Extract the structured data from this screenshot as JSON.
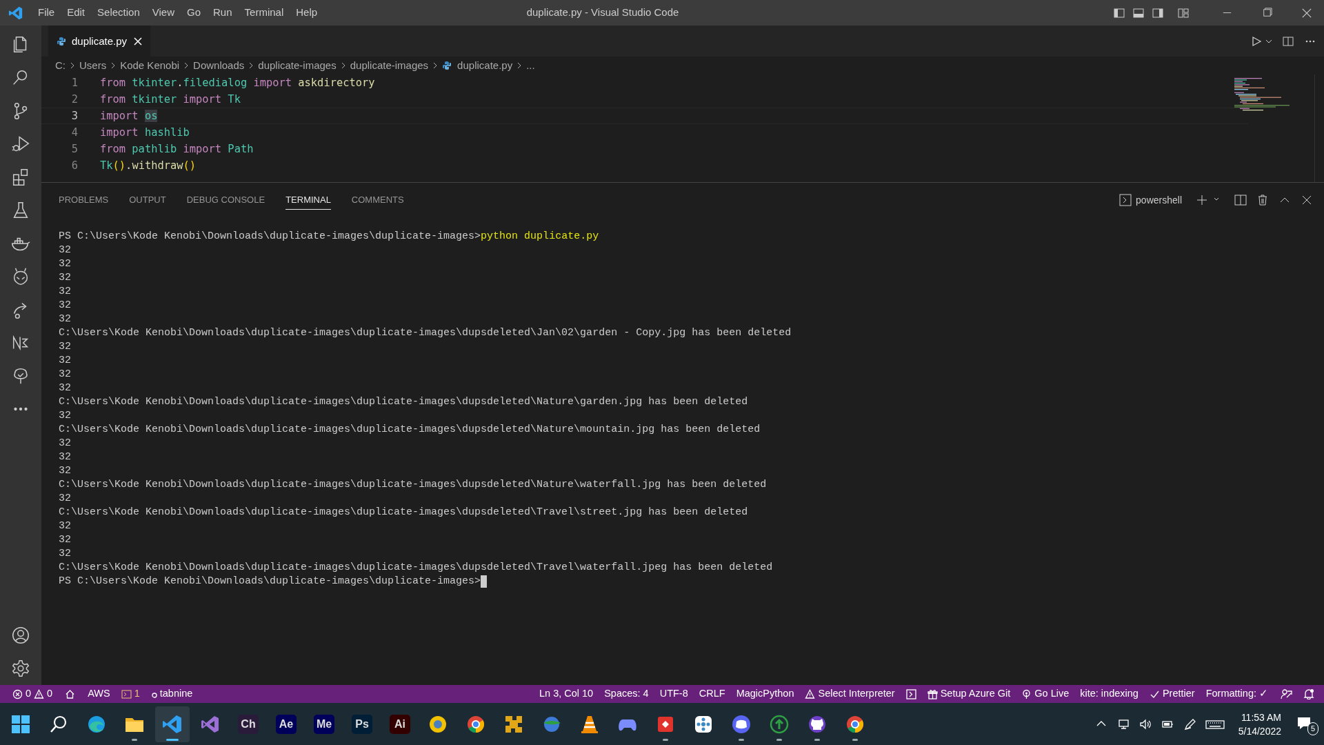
{
  "window": {
    "title": "duplicate.py - Visual Studio Code"
  },
  "menu": [
    "File",
    "Edit",
    "Selection",
    "View",
    "Go",
    "Run",
    "Terminal",
    "Help"
  ],
  "editor_tabs": [
    {
      "label": "duplicate.py",
      "selected": true
    }
  ],
  "breadcrumb": [
    "C:",
    "Users",
    "Kode Kenobi",
    "Downloads",
    "duplicate-images",
    "duplicate-images",
    "duplicate.py",
    "..."
  ],
  "code": [
    {
      "number": "1",
      "current": false,
      "tokens": [
        {
          "kind": "keyword",
          "text": "from",
          "space_after": true
        },
        {
          "kind": "module",
          "text": "tkinter"
        },
        {
          "kind": "plain",
          "text": "."
        },
        {
          "kind": "module",
          "text": "filedialog",
          "space_after": true
        },
        {
          "kind": "keyword",
          "text": "import",
          "space_after": true
        },
        {
          "kind": "func",
          "text": "askdirectory"
        }
      ]
    },
    {
      "number": "2",
      "current": false,
      "tokens": [
        {
          "kind": "keyword",
          "text": "from",
          "space_after": true
        },
        {
          "kind": "module",
          "text": "tkinter",
          "space_after": true
        },
        {
          "kind": "keyword",
          "text": "import",
          "space_after": true
        },
        {
          "kind": "module",
          "text": "Tk"
        }
      ]
    },
    {
      "number": "3",
      "current": true,
      "tokens": [
        {
          "kind": "keyword",
          "text": "import",
          "space_after": true
        },
        {
          "kind": "highlight",
          "text": "os"
        }
      ]
    },
    {
      "number": "4",
      "current": false,
      "tokens": [
        {
          "kind": "keyword",
          "text": "import",
          "space_after": true
        },
        {
          "kind": "module",
          "text": "hashlib"
        }
      ]
    },
    {
      "number": "5",
      "current": false,
      "tokens": [
        {
          "kind": "keyword",
          "text": "from",
          "space_after": true
        },
        {
          "kind": "module",
          "text": "pathlib",
          "space_after": true
        },
        {
          "kind": "keyword",
          "text": "import",
          "space_after": true
        },
        {
          "kind": "module",
          "text": "Path"
        }
      ]
    },
    {
      "number": "6",
      "current": false,
      "tokens": [
        {
          "kind": "module",
          "text": "Tk"
        },
        {
          "kind": "paren",
          "text": "()"
        },
        {
          "kind": "plain",
          "text": "."
        },
        {
          "kind": "func",
          "text": "withdraw"
        },
        {
          "kind": "paren",
          "text": "()"
        }
      ]
    }
  ],
  "panel_tabs": [
    {
      "label": "PROBLEMS",
      "selected": false
    },
    {
      "label": "OUTPUT",
      "selected": false
    },
    {
      "label": "DEBUG CONSOLE",
      "selected": false
    },
    {
      "label": "TERMINAL",
      "selected": true
    },
    {
      "label": "COMMENTS",
      "selected": false
    }
  ],
  "terminal_name": "powershell",
  "terminal": [
    {
      "kind": "prompt",
      "text": "PS C:\\Users\\Kode Kenobi\\Downloads\\duplicate-images\\duplicate-images>",
      "command": "python duplicate.py"
    },
    {
      "kind": "output",
      "text": "32"
    },
    {
      "kind": "output",
      "text": "32"
    },
    {
      "kind": "output",
      "text": "32"
    },
    {
      "kind": "output",
      "text": "32"
    },
    {
      "kind": "output",
      "text": "32"
    },
    {
      "kind": "output",
      "text": "32"
    },
    {
      "kind": "output",
      "text": "C:\\Users\\Kode Kenobi\\Downloads\\duplicate-images\\duplicate-images\\dupsdeleted\\Jan\\02\\garden - Copy.jpg has been deleted"
    },
    {
      "kind": "output",
      "text": "32"
    },
    {
      "kind": "output",
      "text": "32"
    },
    {
      "kind": "output",
      "text": "32"
    },
    {
      "kind": "output",
      "text": "32"
    },
    {
      "kind": "output",
      "text": "C:\\Users\\Kode Kenobi\\Downloads\\duplicate-images\\duplicate-images\\dupsdeleted\\Nature\\garden.jpg has been deleted"
    },
    {
      "kind": "output",
      "text": "32"
    },
    {
      "kind": "output",
      "text": "C:\\Users\\Kode Kenobi\\Downloads\\duplicate-images\\duplicate-images\\dupsdeleted\\Nature\\mountain.jpg has been deleted"
    },
    {
      "kind": "output",
      "text": "32"
    },
    {
      "kind": "output",
      "text": "32"
    },
    {
      "kind": "output",
      "text": "32"
    },
    {
      "kind": "output",
      "text": "C:\\Users\\Kode Kenobi\\Downloads\\duplicate-images\\duplicate-images\\dupsdeleted\\Nature\\waterfall.jpg has been deleted"
    },
    {
      "kind": "output",
      "text": "32"
    },
    {
      "kind": "output",
      "text": "C:\\Users\\Kode Kenobi\\Downloads\\duplicate-images\\duplicate-images\\dupsdeleted\\Travel\\street.jpg has been deleted"
    },
    {
      "kind": "output",
      "text": "32"
    },
    {
      "kind": "output",
      "text": "32"
    },
    {
      "kind": "output",
      "text": "32"
    },
    {
      "kind": "output",
      "text": "C:\\Users\\Kode Kenobi\\Downloads\\duplicate-images\\duplicate-images\\dupsdeleted\\Travel\\waterfall.jpeg has been deleted"
    },
    {
      "kind": "cursor",
      "text": "PS C:\\Users\\Kode Kenobi\\Downloads\\duplicate-images\\duplicate-images>"
    }
  ],
  "status_left": [
    {
      "kind": "problems",
      "errors": "0",
      "warnings": "0"
    },
    {
      "kind": "home"
    },
    {
      "kind": "text",
      "text": "AWS"
    },
    {
      "kind": "terminal",
      "text": "1"
    },
    {
      "kind": "tabnine",
      "text": "tabnine"
    }
  ],
  "status_right": [
    {
      "kind": "text",
      "text": "Ln 3, Col 10"
    },
    {
      "kind": "text",
      "text": "Spaces: 4"
    },
    {
      "kind": "text",
      "text": "UTF-8"
    },
    {
      "kind": "text",
      "text": "CRLF"
    },
    {
      "kind": "text",
      "text": "MagicPython"
    },
    {
      "kind": "warning",
      "text": "Select Interpreter"
    },
    {
      "kind": "terminal-icon"
    },
    {
      "kind": "gift",
      "text": "Setup Azure Git"
    },
    {
      "kind": "live",
      "text": "Go Live"
    },
    {
      "kind": "text",
      "text": "kite: indexing"
    },
    {
      "kind": "check",
      "text": "Prettier"
    },
    {
      "kind": "text",
      "text": "Formatting: ✓"
    },
    {
      "kind": "feedback"
    },
    {
      "kind": "bell"
    }
  ],
  "taskbar": [
    {
      "kind": "start",
      "running": false,
      "selected": false
    },
    {
      "kind": "search",
      "running": false,
      "selected": false
    },
    {
      "kind": "edge",
      "running": false,
      "selected": false
    },
    {
      "kind": "folder",
      "running": true,
      "selected": false
    },
    {
      "kind": "vscode",
      "running": true,
      "selected": true
    },
    {
      "kind": "vs",
      "running": false,
      "selected": false
    },
    {
      "kind": "label",
      "label": "Ch",
      "color": "#2b1b3a",
      "running": false,
      "selected": false
    },
    {
      "kind": "label",
      "label": "Ae",
      "color": "#00005b",
      "running": false,
      "selected": false
    },
    {
      "kind": "label",
      "label": "Me",
      "color": "#00005b",
      "running": false,
      "selected": false
    },
    {
      "kind": "label",
      "label": "Ps",
      "color": "#001e36",
      "running": false,
      "selected": false
    },
    {
      "kind": "label",
      "label": "Ai",
      "color": "#330000",
      "running": false,
      "selected": false
    },
    {
      "kind": "coin",
      "running": false,
      "selected": false
    },
    {
      "kind": "chrome",
      "running": false,
      "selected": false
    },
    {
      "kind": "puzzle",
      "running": false,
      "selected": false
    },
    {
      "kind": "globe",
      "running": false,
      "selected": false
    },
    {
      "kind": "cone",
      "running": false,
      "selected": false
    },
    {
      "kind": "gamepad",
      "running": false,
      "selected": false
    },
    {
      "kind": "diamond",
      "running": true,
      "selected": false
    },
    {
      "kind": "flower",
      "running": false,
      "selected": false
    },
    {
      "kind": "discord",
      "running": true,
      "selected": false
    },
    {
      "kind": "upload",
      "running": true,
      "selected": false
    },
    {
      "kind": "octo",
      "running": true,
      "selected": false
    },
    {
      "kind": "chrome",
      "running": true,
      "selected": false
    }
  ],
  "clock": {
    "time": "11:53 AM",
    "date": "5/14/2022"
  },
  "notifications": "5"
}
